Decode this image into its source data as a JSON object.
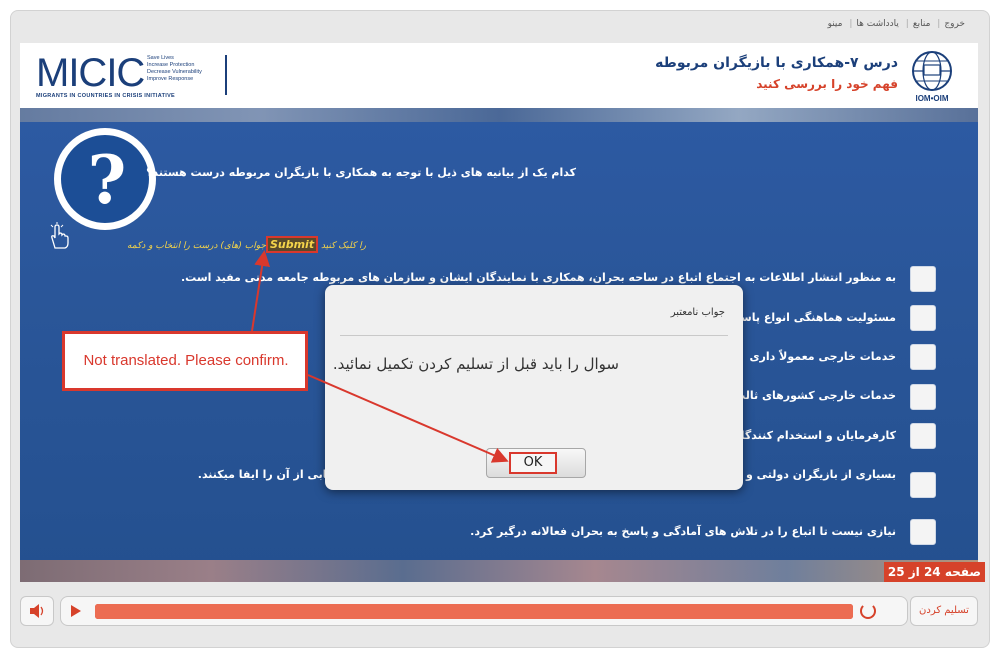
{
  "topnav": {
    "items": [
      "خروج",
      "منابع",
      "یادداشت ها",
      "مینو"
    ]
  },
  "header": {
    "logo_text": "MICIC",
    "logo_tagline": [
      "Save Lives",
      "Increase Protection",
      "Decrease Vulnerability",
      "Improve Response"
    ],
    "logo_subtitle": "MIGRANTS IN COUNTRIES IN CRISIS INITIATIVE",
    "lesson_title": "درس ۷-همکاری با بازیگران مربوطه",
    "lesson_subtitle": "فهم خود را بررسی کنید",
    "iom_label": "IOM•OIM"
  },
  "question": {
    "text": "کدام یک از بیانیه های ذیل با توجه به همکاری با بازیگران مربوطه درست هستند؟",
    "hint_before": "را کلیک کنید",
    "hint_submit": "Submit",
    "hint_after": "جواب (های) درست را انتخاب و دکمه"
  },
  "options": [
    "به منظور انتشار اطلاعات به اجتماع اتباع در ساحه بحران، همکاری با نمایندگان ایشان و سازمان های مربوطه جامعه مدنی مفید است.",
    "مسئولیت هماهنگی انواع پاسخ",
    "خدمات خارجی معمولاً داری",
    "خدمات خارجی کشورهای ثالث",
    "کارفرمایان و استخدام کنندگان",
    "بسیاری از بازیگران دولتی و غیر دولتی که نقش مهمی در تلاش های آمادگی به بحران، و پاسخ به آن و بازیابی از آن را ایفا میکنند.",
    "نیازی نیست تا اتباع را در تلاش های آمادگی و پاسخ به بحران فعالانه درگیر کرد."
  ],
  "progress": {
    "label": "صفحه 24 از 25",
    "current": 24,
    "total": 25
  },
  "player": {
    "progress_fraction": 1.0
  },
  "submit_button": "تسلیم کردن",
  "dialog": {
    "title": "جواب نامعتبر",
    "message": "سوال را باید قبل از تسلیم کردن تکمیل نمائید.",
    "ok_label": "OK"
  },
  "annotation": {
    "text": "Not translated. Please confirm."
  },
  "colors": {
    "accent": "#d6422a",
    "brand_blue": "#1b3f7a",
    "annotation_red": "#d9382d"
  }
}
